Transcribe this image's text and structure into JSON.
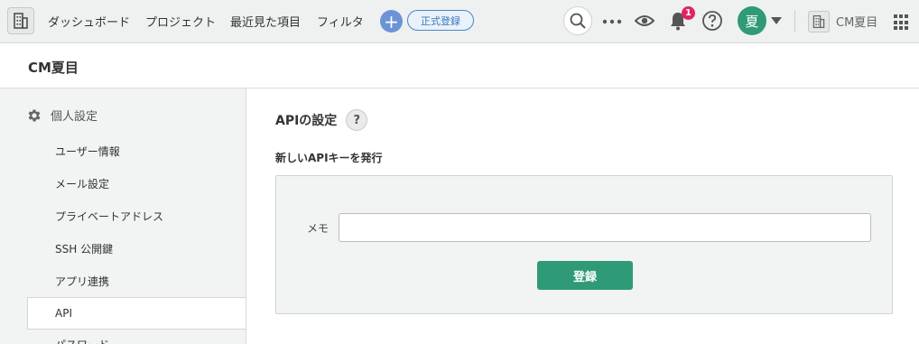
{
  "nav": {
    "items": [
      "ダッシュボード",
      "プロジェクト",
      "最近見た項目",
      "フィルタ"
    ],
    "register_label": "正式登録",
    "notification_count": "1",
    "avatar_initial": "夏",
    "org_name": "CM夏目"
  },
  "project": {
    "title": "CM夏目"
  },
  "sidebar": {
    "heading": "個人設定",
    "items": [
      "ユーザー情報",
      "メール設定",
      "プライベートアドレス",
      "SSH 公開鍵",
      "アプリ連携"
    ],
    "active_item": "API",
    "next_item": "パスワード"
  },
  "main": {
    "title": "APIの設定",
    "help_glyph": "?",
    "section_title": "新しいAPIキーを発行",
    "memo_label": "メモ",
    "memo_value": "",
    "submit_label": "登録"
  },
  "colors": {
    "accent_green": "#2f9a77",
    "badge_red": "#e0245e",
    "link_blue": "#3b78bd"
  }
}
